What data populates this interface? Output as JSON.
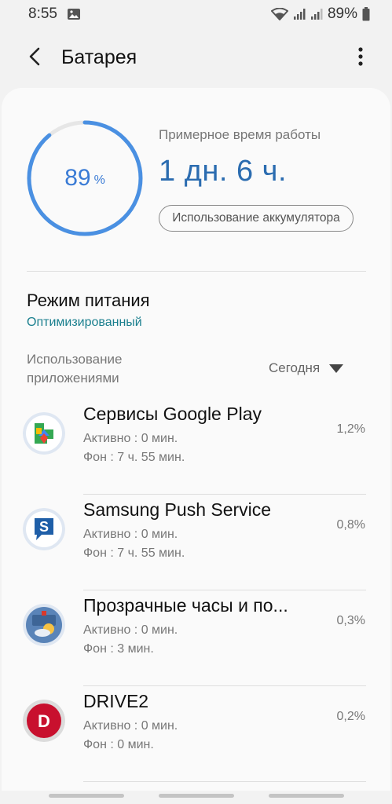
{
  "status_bar": {
    "time": "8:55",
    "battery_percent": "89%",
    "icons": [
      "gallery-notification-icon",
      "wifi-icon",
      "signal-icon",
      "signal-icon-2",
      "battery-icon"
    ]
  },
  "appbar": {
    "title": "Батарея",
    "back_icon": "chevron-left-icon",
    "menu_icon": "more-vertical-icon"
  },
  "battery": {
    "level_value": "89",
    "level_unit": "%",
    "level_fraction": 0.89,
    "estimated_label": "Примерное время работы",
    "estimated_value": "1 дн. 6 ч.",
    "usage_button": "Использование аккумулятора"
  },
  "power_mode": {
    "title": "Режим питания",
    "value": "Оптимизированный"
  },
  "app_usage": {
    "header": "Использование приложениями",
    "period": "Сегодня",
    "apps": [
      {
        "name": "Сервисы Google Play",
        "active": "Активно : 0 мин.",
        "background": "Фон : 7 ч. 55 мин.",
        "percent": "1,2%",
        "icon": "google-play-services-icon"
      },
      {
        "name": "Samsung Push Service",
        "active": "Активно : 0 мин.",
        "background": "Фон : 7 ч. 55 мин.",
        "percent": "0,8%",
        "icon": "samsung-push-icon"
      },
      {
        "name": "Прозрачные часы и по...",
        "active": "Активно : 0 мин.",
        "background": "Фон : 3 мин.",
        "percent": "0,3%",
        "icon": "weather-clock-icon"
      },
      {
        "name": "DRIVE2",
        "active": "Активно : 0 мин.",
        "background": "Фон : 0 мин.",
        "percent": "0,2%",
        "icon": "drive2-icon"
      }
    ]
  },
  "colors": {
    "accent": "#3a7bd5",
    "power_value": "#1a7f8e",
    "background": "#f2f2f2",
    "card": "#fafafa"
  }
}
